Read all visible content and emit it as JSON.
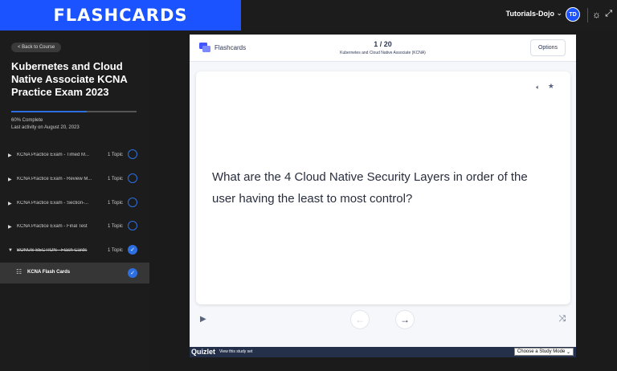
{
  "header": {
    "brand": "FLASHCARDS",
    "user_name": "Tutorials-Dojo",
    "avatar_initials": "TD",
    "accent": "#1a53ff"
  },
  "sidebar": {
    "back_label": "< Back to Course",
    "course_title": "Kubernetes and Cloud Native Associate KCNA Practice Exam 2023",
    "progress": {
      "percent": 60,
      "label": "60% Complete"
    },
    "last_activity": "Last activity on August 20, 2023",
    "sections": [
      {
        "title": "KCNA Practice Exam - Timed M...",
        "topics": "1 Topic",
        "completed": false
      },
      {
        "title": "KCNA Practice Exam - Review M...",
        "topics": "1 Topic",
        "completed": false
      },
      {
        "title": "KCNA Practice Exam - Section-...",
        "topics": "1 Topic",
        "completed": false
      },
      {
        "title": "KCNA Practice Exam - Final Test",
        "topics": "1 Topic",
        "completed": false
      },
      {
        "title": "BONUS SECTION - Flash Cards",
        "topics": "1 Topic",
        "completed": true
      }
    ],
    "active_lesson": {
      "title": "KCNA Flash Cards",
      "completed": true
    }
  },
  "flashcards": {
    "label": "Flashcards",
    "counter": "1 / 20",
    "set_title": "Kubernetes and Cloud Native Associate (KCNA)",
    "options_label": "Options",
    "question": "What are the 4 Cloud Native Security Layers in order of the user having the least to most control?"
  },
  "quizlet": {
    "logo": "Quizlet",
    "view_link": "View this study set",
    "study_mode": "Choose a Study Mode"
  }
}
